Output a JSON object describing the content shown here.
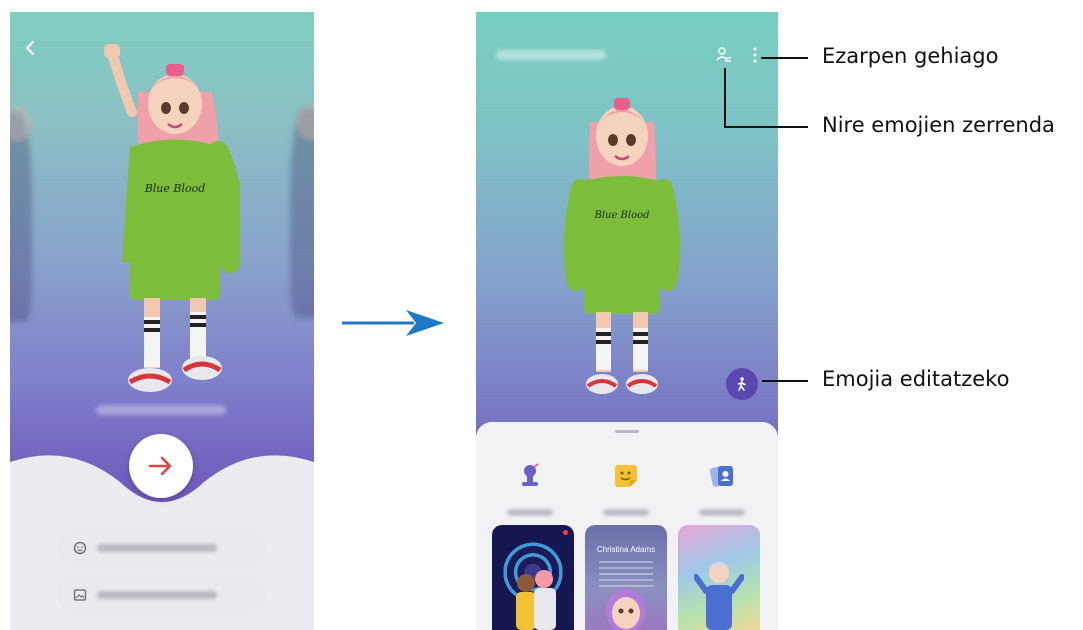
{
  "screen1": {
    "back_icon": "chevron-left-icon",
    "next_button_icon": "arrow-right-icon",
    "options": [
      {
        "icon": "face-icon"
      },
      {
        "icon": "image-icon"
      }
    ]
  },
  "flow_arrow_color": "#1e78c8",
  "screen2": {
    "icons": {
      "my_emojis": "person-list-icon",
      "more": "more-vertical-icon",
      "edit": "person-walk-icon"
    },
    "categories": [
      {
        "icon": "studio-icon"
      },
      {
        "icon": "sticker-icon"
      },
      {
        "icon": "profile-cards-icon"
      }
    ],
    "cards": [
      {
        "title": ""
      },
      {
        "title": "Christina Adams"
      },
      {
        "title": ""
      }
    ]
  },
  "callouts": {
    "more_settings": "Ezarpen gehiago",
    "my_emoji_list": "Nire emojien zerrenda",
    "edit_emoji": "Emojia editatzeko"
  },
  "colors": {
    "accent_purple": "#5a48b0",
    "next_arrow": "#e0454b"
  }
}
